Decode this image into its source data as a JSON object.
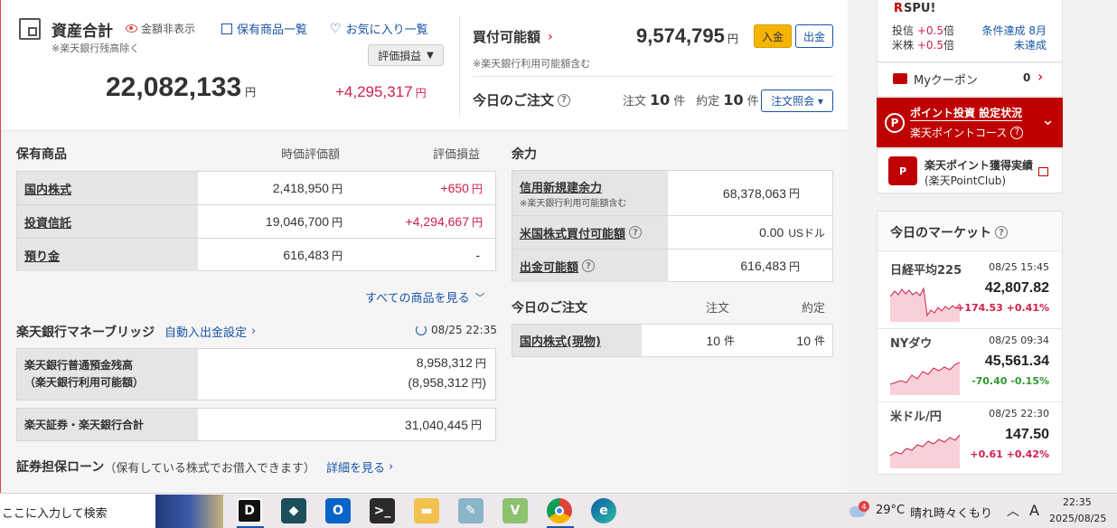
{
  "header": {
    "assets_title": "資産合計",
    "hide_amount": "金額非表示",
    "excl_note": "※楽天銀行残高除く",
    "holdings_list": "保有商品一覧",
    "favorites": "お気に入り一覧",
    "eval_select": "評価損益",
    "total_assets": "22,082,133",
    "total_unit": "円",
    "total_pl": "+4,295,317",
    "total_pl_unit": "円"
  },
  "buying_power": {
    "label": "買付可能額",
    "value": "9,574,795",
    "unit": "円",
    "deposit_btn": "入金",
    "withdraw_btn": "出金",
    "note": "※楽天銀行利用可能額含む"
  },
  "today_orders_head": {
    "label": "今日のご注文",
    "order_label": "注文",
    "order_count": "10",
    "exec_label": "約定",
    "exec_count": "10",
    "count_unit": "件",
    "inquiry_btn": "注文照会 ▾"
  },
  "holdings": {
    "title": "保有商品",
    "col_value": "時価評価額",
    "col_pl": "評価損益",
    "rows": [
      {
        "name": "国内株式",
        "value": "2,418,950",
        "unit": "円",
        "pl": "+650",
        "pl_unit": "円"
      },
      {
        "name": "投資信託",
        "value": "19,046,700",
        "unit": "円",
        "pl": "+4,294,667",
        "pl_unit": "円"
      },
      {
        "name": "預り金",
        "value": "616,483",
        "unit": "円",
        "pl": "-",
        "pl_unit": ""
      }
    ],
    "see_all": "すべての商品を見る"
  },
  "capacity": {
    "title": "余力",
    "rows": [
      {
        "name": "信用新規建余力",
        "sub": "※楽天銀行利用可能額含む",
        "value": "68,378,063",
        "unit": "円"
      },
      {
        "name": "米国株式買付可能額",
        "value": "0.00",
        "unit": "USドル"
      },
      {
        "name": "出金可能額",
        "value": "616,483",
        "unit": "円"
      }
    ]
  },
  "today_orders": {
    "title": "今日のご注文",
    "col_order": "注文",
    "col_exec": "約定",
    "rows": [
      {
        "name": "国内株式(現物)",
        "order": "10",
        "exec": "10",
        "unit": "件"
      }
    ]
  },
  "bridge": {
    "title": "楽天銀行マネーブリッジ",
    "auto_link": "自動入出金設定",
    "timestamp": "08/25 22:35",
    "balance_label1": "楽天銀行普通預金残高",
    "balance_label2": "（楽天銀行利用可能額）",
    "balance": "8,958,312",
    "balance_avail": "(8,958,312",
    "balance_unit": "円",
    "balance_close": ")",
    "total_label": "楽天証券・楽天銀行合計",
    "total": "31,040,445",
    "total_unit": "円"
  },
  "loan": {
    "title": "証券担保ローン",
    "sub": "（保有している株式でお借入できます）",
    "details": "詳細を見る"
  },
  "spu": {
    "title": "SPU!",
    "r1_label": "投信",
    "r1_value": "+0.5",
    "r1_unit": "倍",
    "r1_link": "条件達成 8月",
    "r2_label": "米株",
    "r2_value": "+0.5",
    "r2_unit": "倍",
    "r2_link": "未達成"
  },
  "coupon": {
    "label": "Myクーポン",
    "count": "0"
  },
  "point_invest": {
    "title": "ポイント投資 設定状況",
    "course": "楽天ポイントコース"
  },
  "point_record": {
    "title": "楽天ポイント獲得実績",
    "sub": "(楽天PointClub)"
  },
  "market": {
    "title": "今日のマーケット",
    "items": [
      {
        "name": "日経平均225",
        "time": "08/25 15:45",
        "value": "42,807.82",
        "change": "+174.53",
        "pct": "+0.41%",
        "color": "#d0204a"
      },
      {
        "name": "NYダウ",
        "time": "08/25 09:34",
        "value": "45,561.34",
        "change": "-70.40",
        "pct": "-0.15%",
        "color": "#2e9a2e"
      },
      {
        "name": "米ドル/円",
        "time": "08/25 22:30",
        "value": "147.50",
        "change": "+0.61",
        "pct": "+0.42%",
        "color": "#d0204a"
      }
    ]
  },
  "taskbar": {
    "search": "ここに入力して検索",
    "weather_temp": "29°C",
    "weather_desc": "晴れ時々くもり",
    "ime": "A",
    "time": "22:35",
    "date": "2025/08/25",
    "weather_badge": "4"
  },
  "colors": {
    "accent": "#1a55a6",
    "rakuten_red": "#bf0000",
    "positive": "#d0204a",
    "negative": "#2e9a2e",
    "deposit_btn": "#f5b400"
  }
}
